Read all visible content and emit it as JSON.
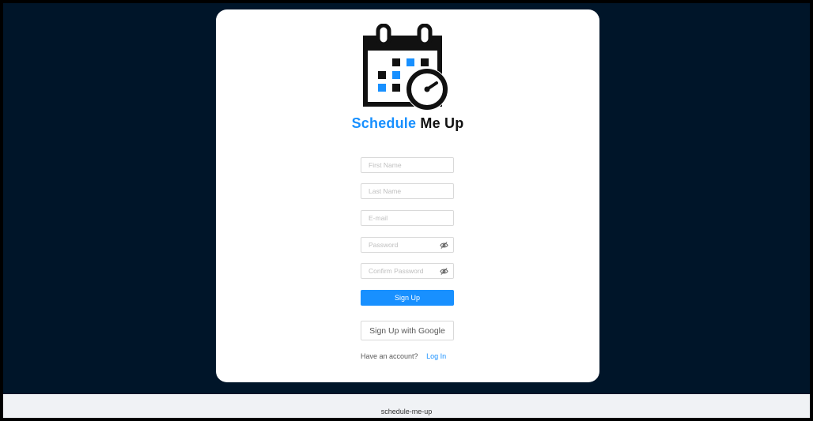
{
  "brand": {
    "part1": "Schedule",
    "part2": "Me Up"
  },
  "form": {
    "first_name_placeholder": "First Name",
    "last_name_placeholder": "Last Name",
    "email_placeholder": "E-mail",
    "password_placeholder": "Password",
    "confirm_password_placeholder": "Confirm Password",
    "signup_label": "Sign Up",
    "google_label": "Sign Up with Google",
    "have_account_text": "Have an account?",
    "login_label": "Log In"
  },
  "footer": {
    "text": "schedule-me-up"
  },
  "colors": {
    "background": "#001529",
    "accent": "#1890ff",
    "footer_bg": "#f0f2f5"
  },
  "icons": {
    "logo": "calendar-clock-icon",
    "password_toggle": "eye-invisible-icon"
  }
}
